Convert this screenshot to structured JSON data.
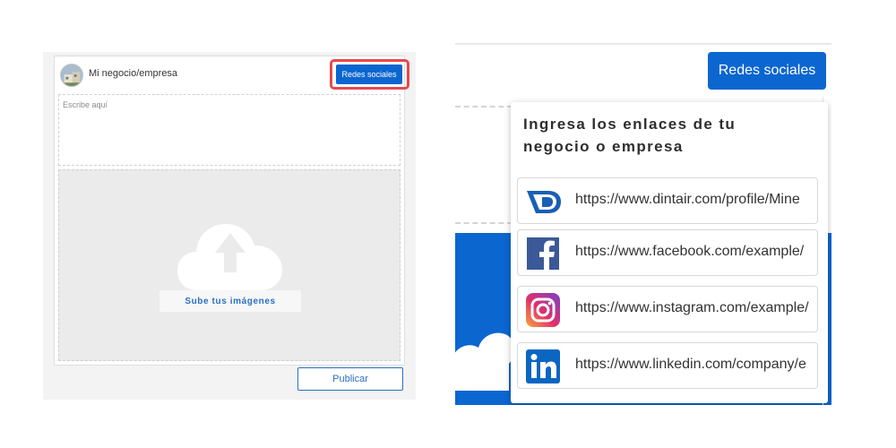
{
  "left": {
    "business_name": "Mi negocio/empresa",
    "social_button_label": "Redes sociales",
    "text_placeholder": "Escribe aquí",
    "upload_label": "Sube tus imágenes",
    "publish_label": "Publicar",
    "highlight_color": "#e8484d",
    "accent_color": "#0b66d0"
  },
  "right": {
    "social_button_label": "Redes sociales",
    "popup_title": "Ingresa los enlaces de tu negocio o empresa",
    "links": [
      {
        "network": "dintair",
        "icon": "dintair-logo-icon",
        "url": "https://www.dintair.com/profile/Mine"
      },
      {
        "network": "facebook",
        "icon": "facebook-logo-icon",
        "url": "https://www.facebook.com/example/"
      },
      {
        "network": "instagram",
        "icon": "instagram-logo-icon",
        "url": "https://www.instagram.com/example/"
      },
      {
        "network": "linkedin",
        "icon": "linkedin-logo-icon",
        "url": "https://www.linkedin.com/company/e"
      }
    ]
  }
}
